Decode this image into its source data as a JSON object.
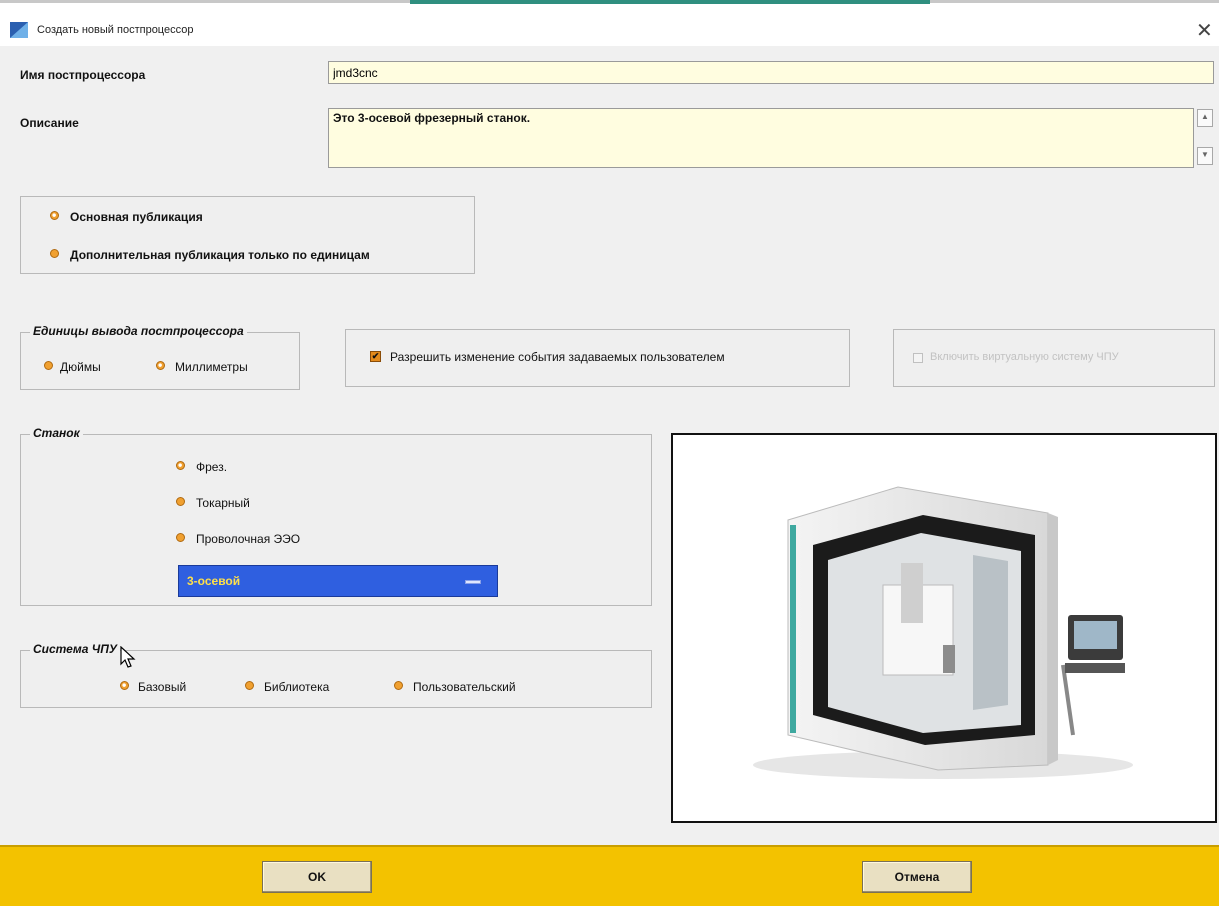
{
  "window": {
    "title": "Создать новый постпроцессор",
    "close_glyph": "✕"
  },
  "form": {
    "name_label": "Имя постпроцессора",
    "name_value": "jmd3cnc",
    "description_label": "Описание",
    "description_value": "Это 3-осевой фрезерный станок.",
    "scroll_up_glyph": "▲",
    "scroll_down_glyph": "▼"
  },
  "publication": {
    "options": [
      {
        "label": "Основная публикация",
        "selected": true
      },
      {
        "label": "Дополнительная публикация только по единицам",
        "selected": false
      }
    ]
  },
  "units": {
    "legend": "Единицы вывода постпроцессора",
    "options": [
      {
        "label": "Дюймы",
        "selected": false
      },
      {
        "label": "Миллиметры",
        "selected": true
      }
    ]
  },
  "allow_events": {
    "label": "Разрешить изменение события задаваемых пользователем",
    "checked": true,
    "check_glyph": "✔"
  },
  "disabled_option": {
    "label": "Включить виртуальную систему ЧПУ",
    "checked": false
  },
  "machine": {
    "legend": "Станок",
    "options": [
      {
        "label": "Фрез.",
        "selected": true
      },
      {
        "label": "Токарный",
        "selected": false
      },
      {
        "label": "Проволочная ЭЭО",
        "selected": false
      }
    ],
    "axis_select_value": "3-осевой"
  },
  "controller": {
    "legend": "Система ЧПУ",
    "options": [
      {
        "label": "Базовый",
        "selected": true
      },
      {
        "label": "Библиотека",
        "selected": false
      },
      {
        "label": "Пользовательский",
        "selected": false
      }
    ]
  },
  "footer": {
    "ok_label": "OK",
    "cancel_label": "Отмена"
  },
  "colors": {
    "footer_bg": "#f3c200",
    "field_bg": "#fffde0",
    "dropdown_bg": "#2f5fe0",
    "radio": "#f0a030"
  }
}
